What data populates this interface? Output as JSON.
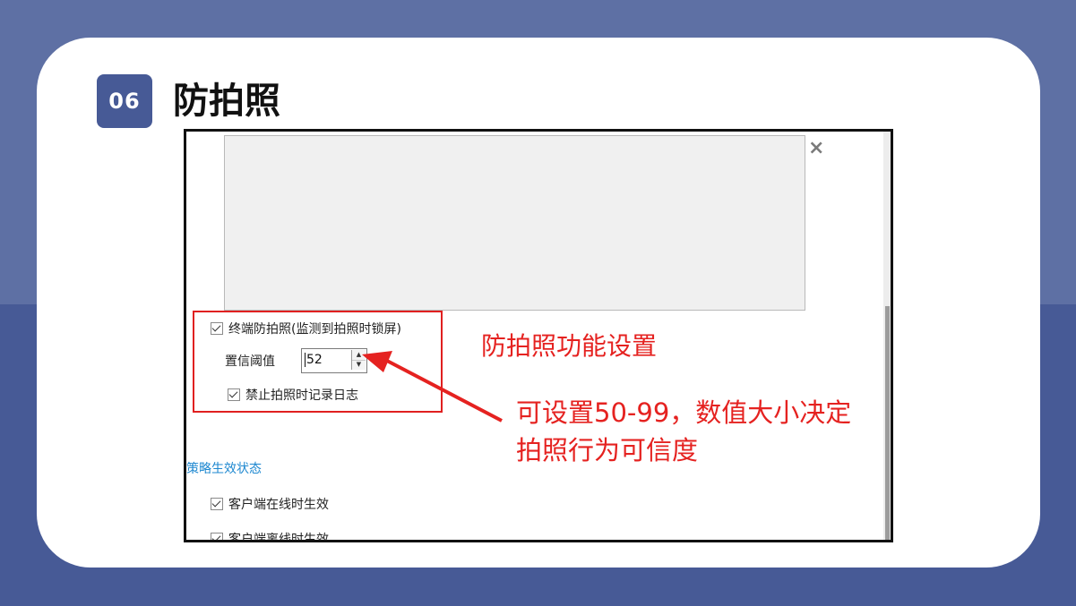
{
  "slide": {
    "number": "06",
    "title": "防拍照"
  },
  "screenshot": {
    "close_icon": "×",
    "anti_photo_checkbox": {
      "label": "终端防拍照(监测到拍照时锁屏)",
      "checked": true
    },
    "confidence": {
      "label": "置信阈值",
      "value": "52"
    },
    "log_checkbox": {
      "label": "禁止拍照时记录日志",
      "checked": true
    },
    "section_title": "策略生效状态",
    "online_checkbox": {
      "label": "客户端在线时生效",
      "checked": true
    },
    "offline_checkbox": {
      "label": "客户端离线时生效",
      "checked": true
    }
  },
  "annotations": {
    "box_caption": "防拍照功能设置",
    "note_line1": "可设置50-99，数值大小决定",
    "note_line2": "拍照行为可信度",
    "color": "#e52220"
  },
  "colors": {
    "background_top": "#5e70a4",
    "background_bottom": "#475a96",
    "badge": "#475a96",
    "section_title": "#1e88d0"
  }
}
